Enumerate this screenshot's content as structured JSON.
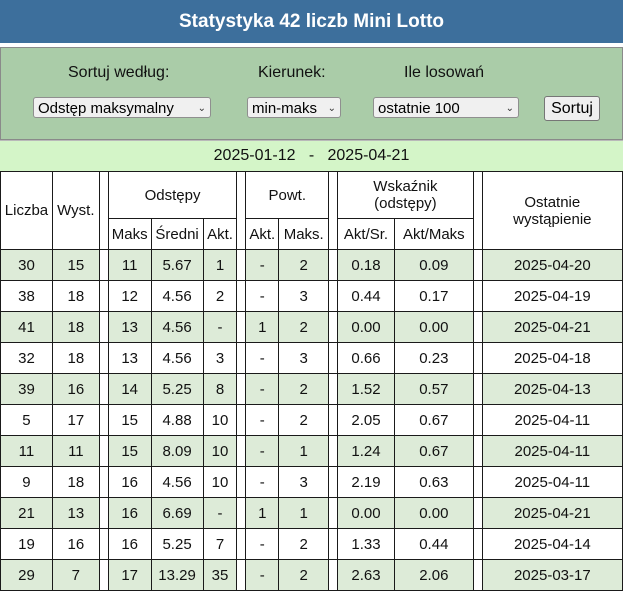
{
  "title": "Statystyka 42 liczb Mini Lotto",
  "controls": {
    "sort_label": "Sortuj według:",
    "direction_label": "Kierunek:",
    "draws_label": "Ile losowań",
    "sort_value": "Odstęp maksymalny",
    "direction_value": "min-maks",
    "draws_value": "ostatnie 100",
    "sort_button": "Sortuj"
  },
  "date_range": {
    "from": "2025-01-12",
    "separator": "-",
    "to": "2025-04-21"
  },
  "headers": {
    "number": "Liczba",
    "occurrences": "Wyst.",
    "gaps": "Odstępy",
    "gaps_max": "Maks",
    "gaps_avg": "Średni",
    "gaps_cur": "Akt.",
    "repeats": "Powt.",
    "repeats_cur": "Akt.",
    "repeats_max": "Maks.",
    "indicator_line1": "Wskaźnik",
    "indicator_line2": "(odstępy)",
    "ind_cur_avg": "Akt/Sr.",
    "ind_cur_max": "Akt/Maks",
    "last_line1": "Ostatnie",
    "last_line2": "wystąpienie"
  },
  "rows": [
    {
      "number": "30",
      "occ": "15",
      "gmax": "11",
      "gavg": "5.67",
      "gcur": "1",
      "rcur": "-",
      "rmax": "2",
      "icur": "0.18",
      "imax": "0.09",
      "last": "2025-04-20"
    },
    {
      "number": "38",
      "occ": "18",
      "gmax": "12",
      "gavg": "4.56",
      "gcur": "2",
      "rcur": "-",
      "rmax": "3",
      "icur": "0.44",
      "imax": "0.17",
      "last": "2025-04-19"
    },
    {
      "number": "41",
      "occ": "18",
      "gmax": "13",
      "gavg": "4.56",
      "gcur": "-",
      "rcur": "1",
      "rmax": "2",
      "icur": "0.00",
      "imax": "0.00",
      "last": "2025-04-21"
    },
    {
      "number": "32",
      "occ": "18",
      "gmax": "13",
      "gavg": "4.56",
      "gcur": "3",
      "rcur": "-",
      "rmax": "3",
      "icur": "0.66",
      "imax": "0.23",
      "last": "2025-04-18"
    },
    {
      "number": "39",
      "occ": "16",
      "gmax": "14",
      "gavg": "5.25",
      "gcur": "8",
      "rcur": "-",
      "rmax": "2",
      "icur": "1.52",
      "imax": "0.57",
      "last": "2025-04-13"
    },
    {
      "number": "5",
      "occ": "17",
      "gmax": "15",
      "gavg": "4.88",
      "gcur": "10",
      "rcur": "-",
      "rmax": "2",
      "icur": "2.05",
      "imax": "0.67",
      "last": "2025-04-11"
    },
    {
      "number": "11",
      "occ": "11",
      "gmax": "15",
      "gavg": "8.09",
      "gcur": "10",
      "rcur": "-",
      "rmax": "1",
      "icur": "1.24",
      "imax": "0.67",
      "last": "2025-04-11"
    },
    {
      "number": "9",
      "occ": "18",
      "gmax": "16",
      "gavg": "4.56",
      "gcur": "10",
      "rcur": "-",
      "rmax": "3",
      "icur": "2.19",
      "imax": "0.63",
      "last": "2025-04-11"
    },
    {
      "number": "21",
      "occ": "13",
      "gmax": "16",
      "gavg": "6.69",
      "gcur": "-",
      "rcur": "1",
      "rmax": "1",
      "icur": "0.00",
      "imax": "0.00",
      "last": "2025-04-21"
    },
    {
      "number": "19",
      "occ": "16",
      "gmax": "16",
      "gavg": "5.25",
      "gcur": "7",
      "rcur": "-",
      "rmax": "2",
      "icur": "1.33",
      "imax": "0.44",
      "last": "2025-04-14"
    },
    {
      "number": "29",
      "occ": "7",
      "gmax": "17",
      "gavg": "13.29",
      "gcur": "35",
      "rcur": "-",
      "rmax": "2",
      "icur": "2.63",
      "imax": "2.06",
      "last": "2025-03-17"
    }
  ]
}
